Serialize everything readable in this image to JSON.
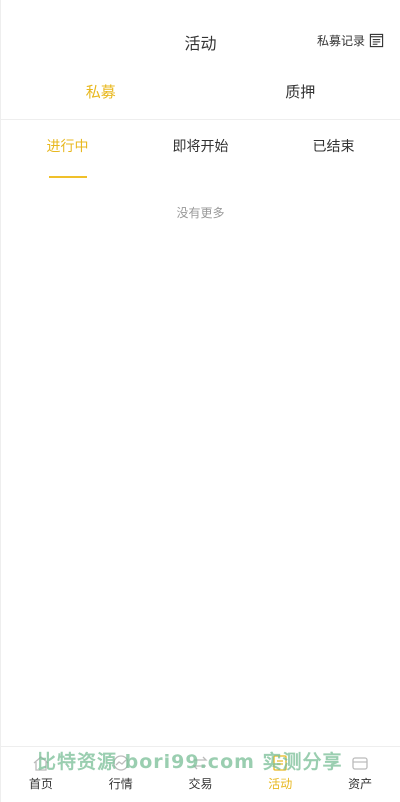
{
  "header": {
    "title": "活动",
    "record_label": "私募记录",
    "record_icon": "document-list-icon"
  },
  "top_tabs": [
    {
      "label": "私募",
      "active": true
    },
    {
      "label": "质押",
      "active": false
    }
  ],
  "sub_tabs": [
    {
      "label": "进行中",
      "active": true
    },
    {
      "label": "即将开始",
      "active": false
    },
    {
      "label": "已结束",
      "active": false
    }
  ],
  "list": {
    "empty_text": "没有更多"
  },
  "bottom_nav": [
    {
      "label": "首页",
      "icon": "home-icon",
      "active": false
    },
    {
      "label": "行情",
      "icon": "market-icon",
      "active": false
    },
    {
      "label": "交易",
      "icon": "trade-icon",
      "active": false
    },
    {
      "label": "活动",
      "icon": "activity-icon",
      "active": true
    },
    {
      "label": "资产",
      "icon": "assets-icon",
      "active": false
    }
  ],
  "watermark": "比特资源 bori99.com 实测分享",
  "colors": {
    "accent": "#e8b820",
    "text": "#333333",
    "muted": "#999999",
    "divider": "#eeeeee"
  }
}
